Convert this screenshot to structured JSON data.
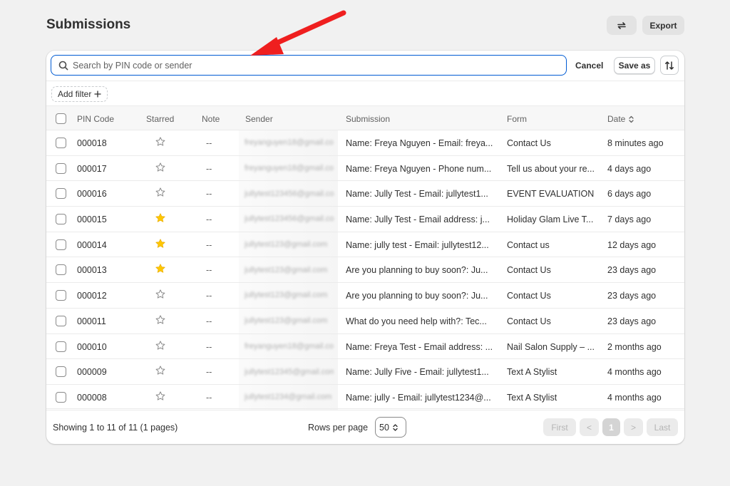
{
  "page": {
    "title": "Submissions"
  },
  "top_actions": {
    "export_label": "Export",
    "sync_icon": "sync-icon"
  },
  "search": {
    "placeholder": "Search by PIN code or sender",
    "value": ""
  },
  "toolbar": {
    "cancel_label": "Cancel",
    "save_as_label": "Save as"
  },
  "filter": {
    "add_filter_label": "Add filter"
  },
  "table": {
    "columns": [
      "PIN Code",
      "Starred",
      "Note",
      "Sender",
      "Submission",
      "Form",
      "Date"
    ],
    "rows": [
      {
        "pin": "000018",
        "starred": false,
        "note": "--",
        "sender": "freyanguyen18@gmail.com",
        "submission": "Name: Freya Nguyen - Email: freya...",
        "form": "Contact Us",
        "date": "8 minutes ago"
      },
      {
        "pin": "000017",
        "starred": false,
        "note": "--",
        "sender": "freyanguyen18@gmail.com",
        "submission": "Name: Freya Nguyen - Phone num...",
        "form": "Tell us about your re...",
        "date": "4 days ago"
      },
      {
        "pin": "000016",
        "starred": false,
        "note": "--",
        "sender": "jullytest123456@gmail.com",
        "submission": "Name: Jully Test - Email: jullytest1...",
        "form": "EVENT EVALUATION",
        "date": "6 days ago"
      },
      {
        "pin": "000015",
        "starred": true,
        "note": "--",
        "sender": "jullytest123456@gmail.com",
        "submission": "Name: Jully Test - Email address: j...",
        "form": "Holiday Glam Live T...",
        "date": "7 days ago"
      },
      {
        "pin": "000014",
        "starred": true,
        "note": "--",
        "sender": "jullytest123@gmail.com",
        "submission": "Name: jully test - Email: jullytest12...",
        "form": "Contact us",
        "date": "12 days ago"
      },
      {
        "pin": "000013",
        "starred": true,
        "note": "--",
        "sender": "jullytest123@gmail.com",
        "submission": "Are you planning to buy soon?: Ju...",
        "form": "Contact Us",
        "date": "23 days ago"
      },
      {
        "pin": "000012",
        "starred": false,
        "note": "--",
        "sender": "jullytest123@gmail.com",
        "submission": "Are you planning to buy soon?: Ju...",
        "form": "Contact Us",
        "date": "23 days ago"
      },
      {
        "pin": "000011",
        "starred": false,
        "note": "--",
        "sender": "jullytest123@gmail.com",
        "submission": "What do you need help with?: Tec...",
        "form": "Contact Us",
        "date": "23 days ago"
      },
      {
        "pin": "000010",
        "starred": false,
        "note": "--",
        "sender": "freyanguyen18@gmail.com",
        "submission": "Name: Freya Test - Email address: ...",
        "form": "Nail Salon Supply – ...",
        "date": "2 months ago"
      },
      {
        "pin": "000009",
        "starred": false,
        "note": "--",
        "sender": "jullytest12345@gmail.com",
        "submission": "Name: Jully Five - Email: jullytest1...",
        "form": "Text A Stylist",
        "date": "4 months ago"
      },
      {
        "pin": "000008",
        "starred": false,
        "note": "--",
        "sender": "jullytest1234@gmail.com",
        "submission": "Name: jully - Email: jullytest1234@...",
        "form": "Text A Stylist",
        "date": "4 months ago"
      }
    ]
  },
  "footer": {
    "showing": "Showing 1 to 11 of 11 (1 pages)",
    "rows_per_page_label": "Rows per page",
    "rows_per_page_value": "50",
    "first_label": "First",
    "prev_label": "<",
    "current_page": "1",
    "next_label": ">",
    "last_label": "Last"
  },
  "colors": {
    "accent": "#005bd3",
    "star": "#ffc700",
    "annotation_arrow": "#ef1f1f"
  }
}
